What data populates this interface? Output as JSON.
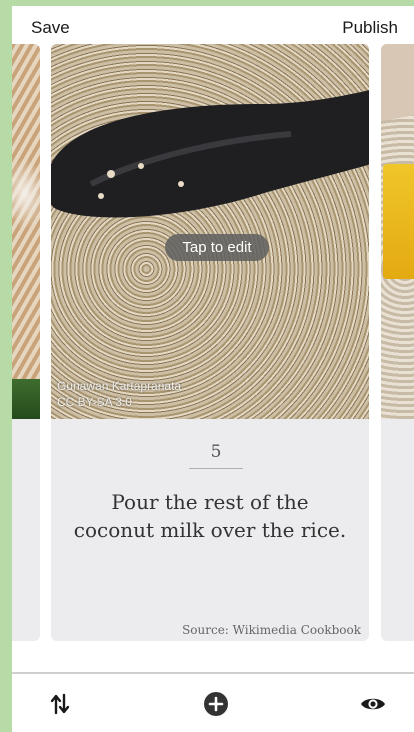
{
  "topbar": {
    "save_label": "Save",
    "publish_label": "Publish"
  },
  "card": {
    "tap_to_edit_label": "Tap to edit",
    "photo_credit_author": "Gunawan Kartapranata",
    "photo_credit_license": "CC BY-SA 3.0",
    "step_number": "5",
    "step_text": "Pour the rest of the coconut milk over the rice.",
    "source_text": "Source: Wikimedia Cookbook"
  },
  "bottombar": {
    "reorder_icon": "swap-vertical-icon",
    "add_icon": "add-circle-icon",
    "preview_icon": "eye-icon"
  },
  "colors": {
    "frame_background": "#b7dba6",
    "card_background": "#ececef",
    "icon_color": "#1a1a1a"
  }
}
